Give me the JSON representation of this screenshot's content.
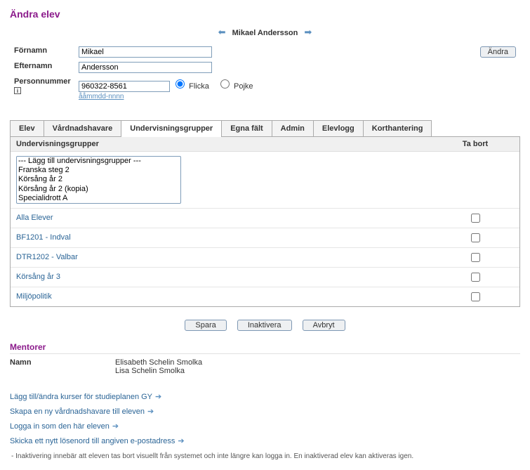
{
  "page_title": "Ändra elev",
  "nav": {
    "name": "Mikael Andersson"
  },
  "form": {
    "fornamn_label": "Förnamn",
    "fornamn_value": "Mikael",
    "efternamn_label": "Efternamn",
    "efternamn_value": "Andersson",
    "personnummer_label": "Personnummer",
    "personnummer_value": "960322-8561",
    "personnummer_hint": "ååmmdd-nnnn",
    "flicka_label": "Flicka",
    "pojke_label": "Pojke",
    "andra_button": "Ändra"
  },
  "tabs": [
    "Elev",
    "Vårdnadshavare",
    "Undervisningsgrupper",
    "Egna fält",
    "Admin",
    "Elevlogg",
    "Korthantering"
  ],
  "active_tab": 2,
  "panel": {
    "header_left": "Undervisningsgrupper",
    "header_right": "Ta bort",
    "select_options": [
      "--- Lägg till undervisningsgrupper ---",
      "Franska steg 2",
      "Körsång år 2",
      "Körsång år 2 (kopia)",
      "Specialidrott A"
    ],
    "rows": [
      "Alla Elever",
      "BF1201 - Indval",
      "DTR1202 - Valbar",
      "Körsång år 3",
      "Miljöpolitik"
    ]
  },
  "actions": {
    "save": "Spara",
    "deactivate": "Inaktivera",
    "cancel": "Avbryt"
  },
  "mentors": {
    "title": "Mentorer",
    "name_label": "Namn",
    "list": [
      "Elisabeth Schelin Smolka",
      "Lisa Schelin Smolka"
    ]
  },
  "links": [
    "Lägg till/ändra kurser för studieplanen GY",
    "Skapa en ny vårdnadshavare till eleven",
    "Logga in som den här eleven",
    "Skicka ett nytt lösenord till angiven e-postadress"
  ],
  "note": "Inaktivering innebär att eleven tas bort visuellt från systemet och inte längre kan logga in. En inaktiverad elev kan aktiveras igen."
}
